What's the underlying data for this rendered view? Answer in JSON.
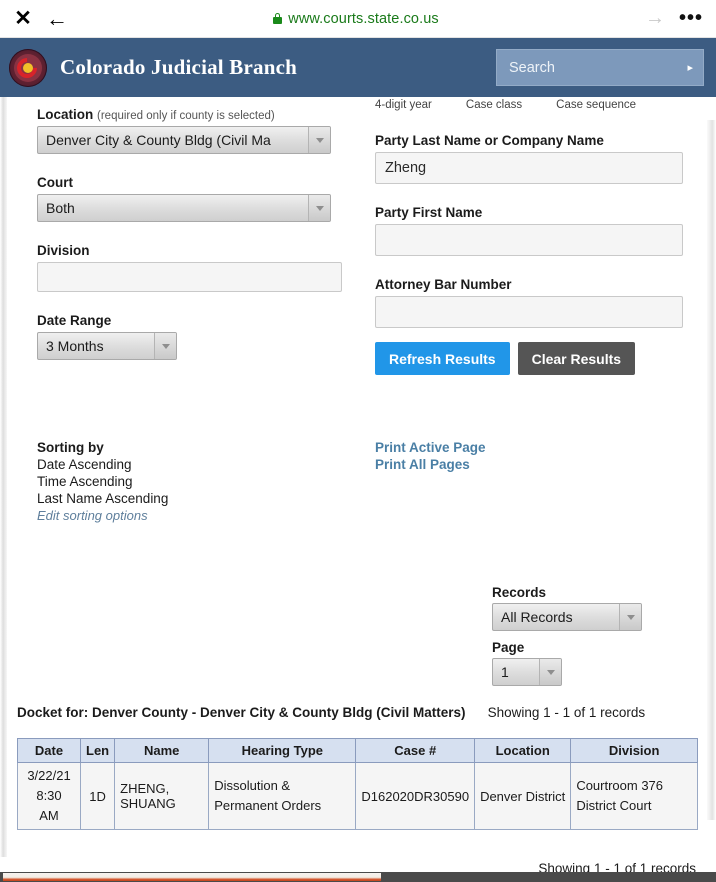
{
  "browser": {
    "close_icon": "close-icon",
    "back_icon": "back-arrow-icon",
    "url": "www.courts.state.co.us",
    "lock_icon": "lock-icon",
    "forward_icon": "forward-arrow-icon",
    "menu_icon": "more-options-icon"
  },
  "header": {
    "logo_name": "colorado-judicial-seal",
    "title": "Colorado Judicial Branch",
    "search_placeholder": "Search",
    "search_submit_glyph": "▸"
  },
  "case_hints": {
    "year": "4-digit year",
    "class": "Case class",
    "sequence": "Case sequence"
  },
  "form_left": {
    "location_label": "Location",
    "location_sublabel": "(required only if county is selected)",
    "location_value": "Denver City & County Bldg (Civil Ma",
    "court_label": "Court",
    "court_value": "Both",
    "division_label": "Division",
    "division_value": "",
    "date_range_label": "Date Range",
    "date_range_value": "3 Months"
  },
  "form_right": {
    "last_name_label": "Party Last Name or Company Name",
    "last_name_value": "Zheng",
    "first_name_label": "Party First Name",
    "first_name_value": "",
    "bar_number_label": "Attorney Bar Number",
    "bar_number_value": "",
    "refresh_button": "Refresh Results",
    "clear_button": "Clear Results"
  },
  "sorting": {
    "heading": "Sorting by",
    "line1": "Date Ascending",
    "line2": "Time Ascending",
    "line3": "Last Name Ascending",
    "edit_link": "Edit sorting options"
  },
  "print": {
    "active_page": "Print Active Page",
    "all_pages": "Print All Pages"
  },
  "paging": {
    "records_label": "Records",
    "records_value": "All Records",
    "page_label": "Page",
    "page_value": "1"
  },
  "docket": {
    "title": "Docket for: Denver County - Denver City & County Bldg (Civil Matters)",
    "showing_top": "Showing 1 - 1 of 1 records",
    "showing_bottom": "Showing 1 - 1 of 1 records",
    "columns": [
      "Date",
      "Len",
      "Name",
      "Hearing Type",
      "Case #",
      "Location",
      "Division"
    ],
    "rows": [
      {
        "date": "3/22/21\n8:30\nAM",
        "len": "1D",
        "name": "ZHENG, SHUANG",
        "hearing_type": "Dissolution &\nPermanent\nOrders",
        "case": "D162020DR30590",
        "location": "Denver District",
        "division": "Courtroom\n376 District\nCourt"
      }
    ]
  },
  "colors": {
    "header_blue": "#3c5c82",
    "search_blue": "#7d99bb",
    "primary_button": "#2196e8",
    "secondary_button": "#555555",
    "link_blue": "#4a7fa5",
    "table_header": "#d6e0f0",
    "url_green": "#1a7a1a",
    "scroll_accent": "#d2532a"
  }
}
